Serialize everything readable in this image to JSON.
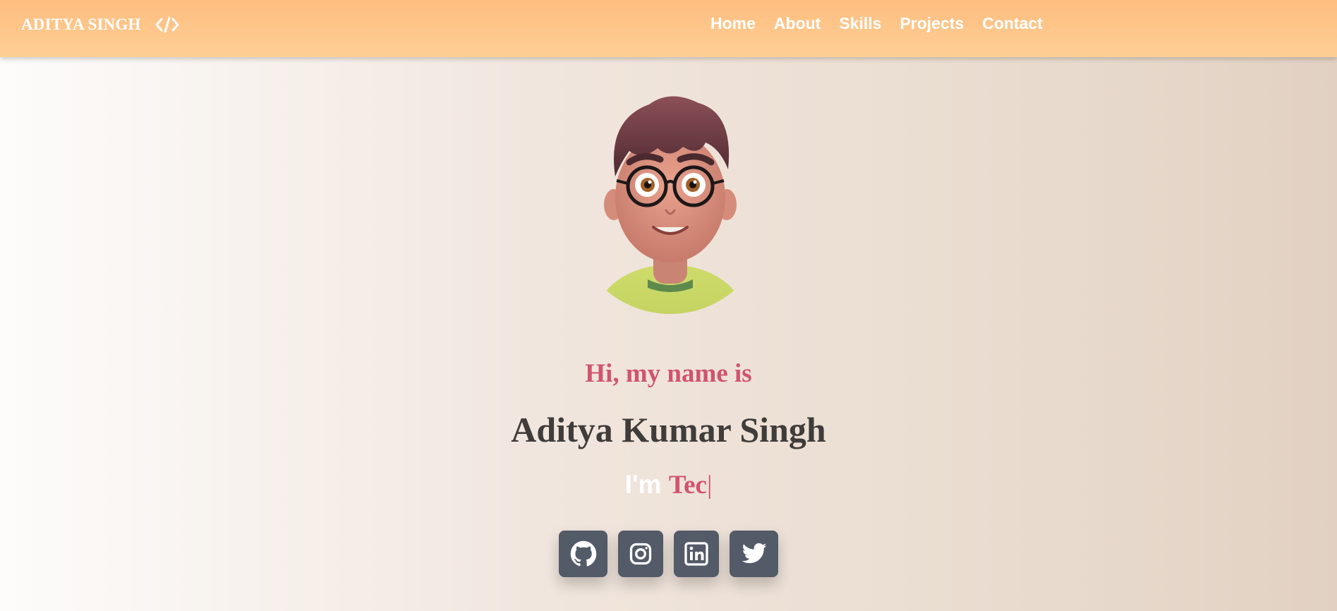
{
  "navbar": {
    "brand": "ADITYA SINGH",
    "brand_icon": "code-icon",
    "links": [
      {
        "label": "Home"
      },
      {
        "label": "About"
      },
      {
        "label": "Skills"
      },
      {
        "label": "Projects"
      },
      {
        "label": "Contact"
      }
    ]
  },
  "hero": {
    "avatar_icon": "avatar-illustration",
    "greeting": "Hi, my name is",
    "name": "Aditya Kumar Singh",
    "typed_prefix": "I'm",
    "typed_word": "Tec",
    "typed_cursor": "|",
    "socials": [
      {
        "label": "GitHub",
        "icon": "github-icon"
      },
      {
        "label": "Instagram",
        "icon": "instagram-icon"
      },
      {
        "label": "LinkedIn",
        "icon": "linkedin-icon"
      },
      {
        "label": "Twitter",
        "icon": "twitter-icon"
      }
    ]
  },
  "colors": {
    "accent": "#d0546f",
    "name_text": "#3f3c39",
    "social_bg": "#535a68",
    "nav_top": "#ffbd7f",
    "nav_bottom": "#fdcf95"
  }
}
